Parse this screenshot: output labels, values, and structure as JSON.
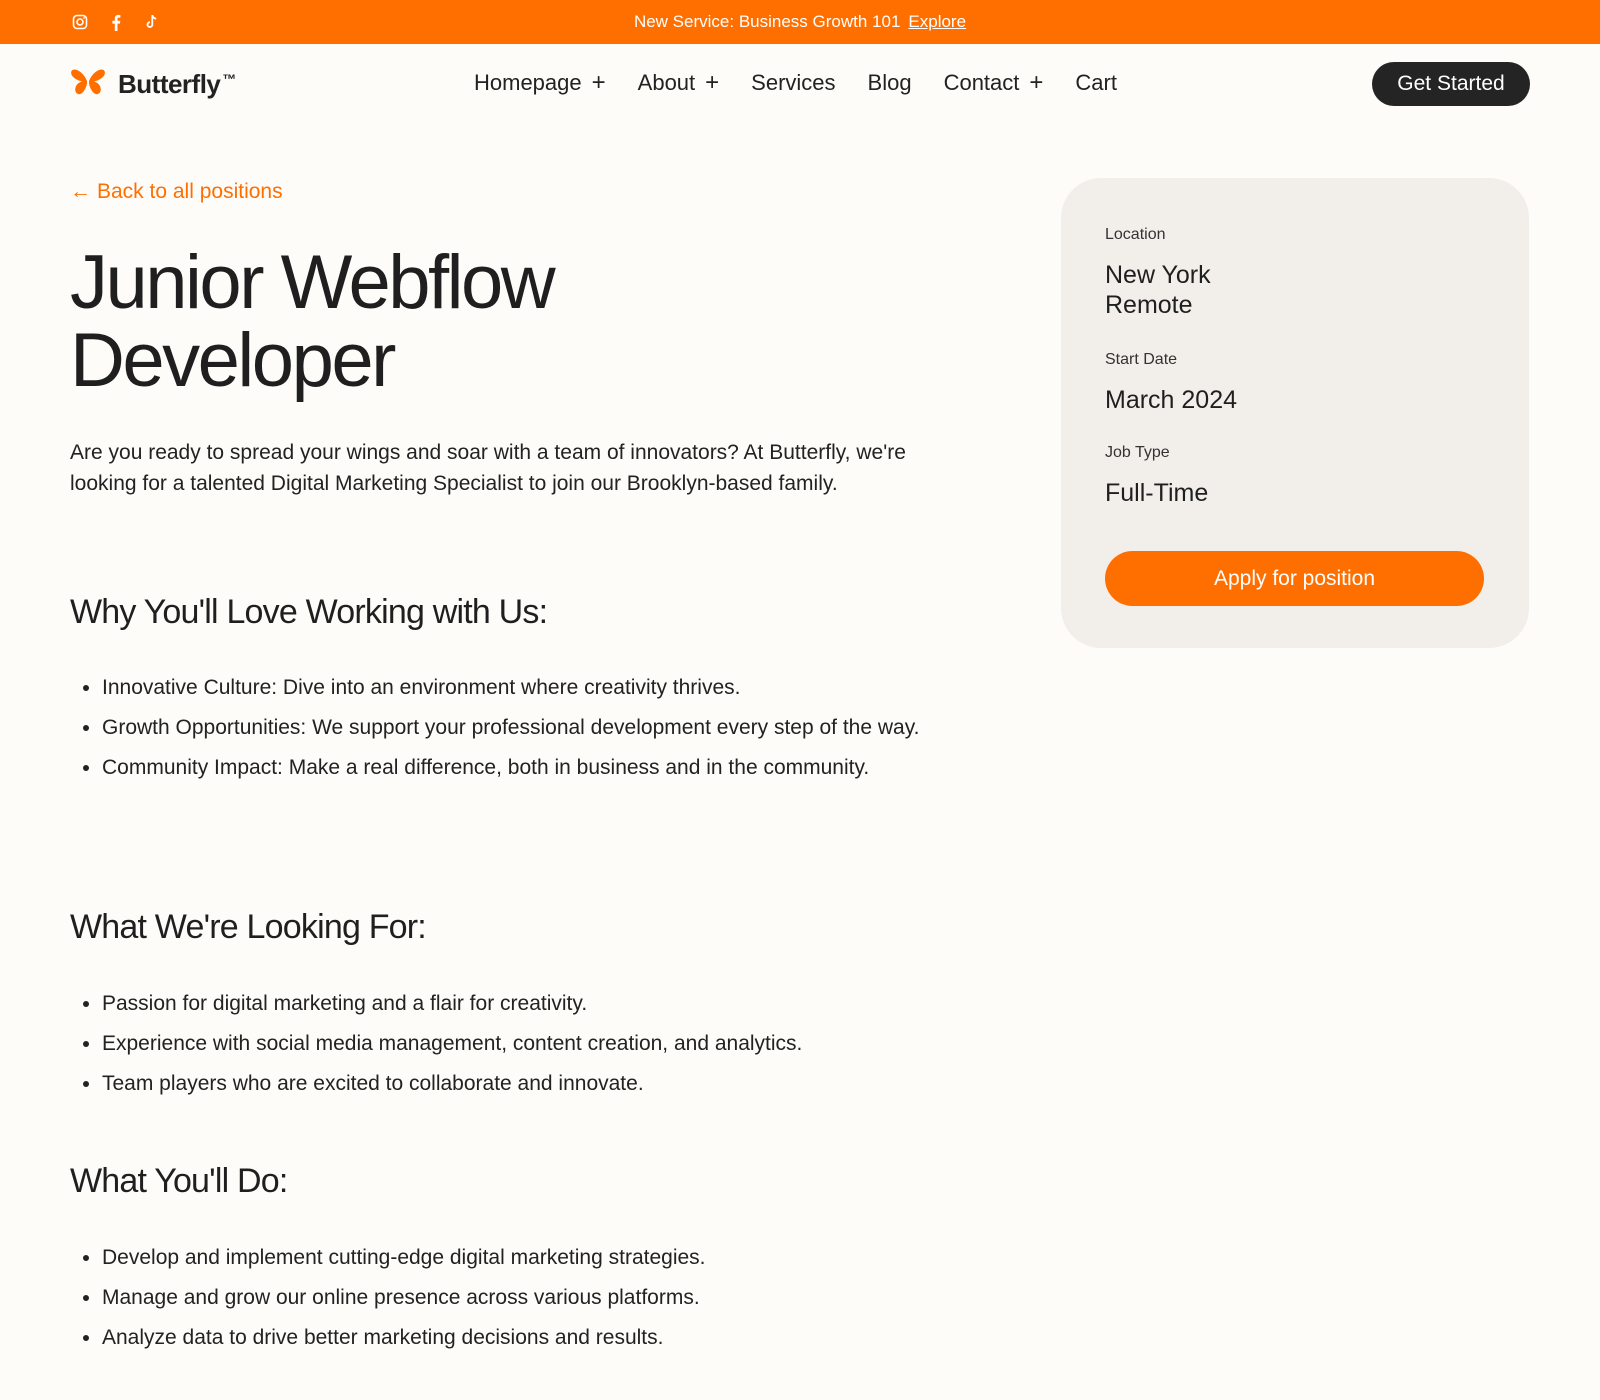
{
  "announcement": {
    "text": "New Service: Business Growth 101",
    "link": "Explore",
    "socials": [
      "instagram-icon",
      "facebook-icon",
      "tiktok-icon"
    ]
  },
  "header": {
    "brand": "Butterfly",
    "trademark": "™",
    "nav": [
      {
        "label": "Homepage",
        "has_submenu": true
      },
      {
        "label": "About",
        "has_submenu": true
      },
      {
        "label": "Services",
        "has_submenu": false
      },
      {
        "label": "Blog",
        "has_submenu": false
      },
      {
        "label": "Contact",
        "has_submenu": true
      },
      {
        "label": "Cart",
        "has_submenu": false
      }
    ],
    "submenu_symbol": "+",
    "cta": "Get Started"
  },
  "main": {
    "back_arrow": "←",
    "back_link": "Back to all positions",
    "title": "Junior Webflow Developer",
    "intro": "Are you ready to spread your wings and soar with a team of innovators? At Butterfly, we're looking for a talented Digital Marketing Specialist to join our Brooklyn-based family.",
    "sections": [
      {
        "title": "Why You'll Love Working with Us:",
        "items": [
          "Innovative Culture: Dive into an environment where creativity thrives.",
          "Growth Opportunities: We support your professional development every step of the way.",
          "Community Impact: Make a real difference, both in business and in the community."
        ]
      },
      {
        "title": "What We're Looking For:",
        "items": [
          "Passion for digital marketing and a flair for creativity.",
          "Experience with social media management, content creation, and analytics.",
          "Team players who are excited to collaborate and innovate."
        ]
      },
      {
        "title": "What You'll Do:",
        "items": [
          "Develop and implement cutting-edge digital marketing strategies.",
          "Manage and grow our online presence across various platforms.",
          "Analyze data to drive better marketing decisions and results."
        ]
      }
    ]
  },
  "card": {
    "location_label": "Location",
    "location_lines": [
      "New York",
      "Remote"
    ],
    "start_label": "Start Date",
    "start_value": "March 2024",
    "type_label": "Job Type",
    "type_value": "Full-Time",
    "apply": "Apply for position"
  },
  "colors": {
    "accent": "#ff6f00",
    "background": "#fdfcf9",
    "card_bg": "#f2efeb",
    "dark_button": "#242424",
    "text": "#222222"
  }
}
